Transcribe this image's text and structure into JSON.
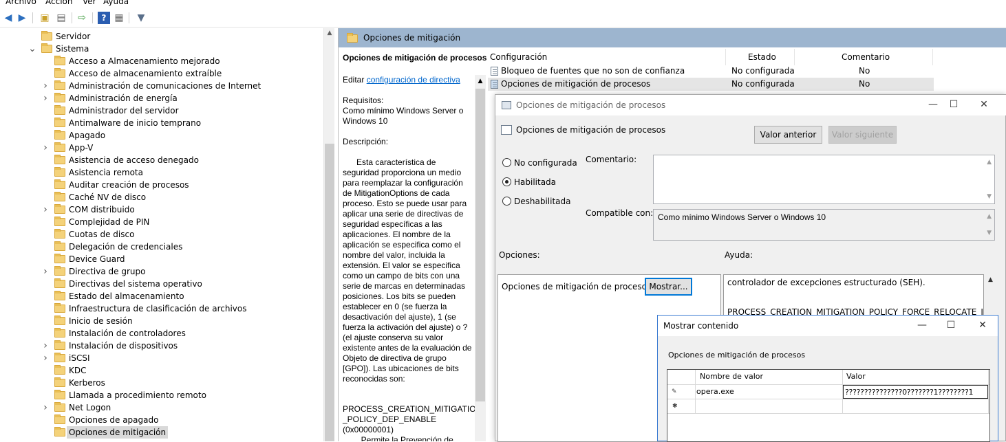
{
  "menu": {
    "items": [
      "Archivo",
      "Acción",
      "Ver",
      "Ayuda"
    ]
  },
  "tree": {
    "items": [
      {
        "label": "Servidor",
        "level": 1,
        "expander": ""
      },
      {
        "label": "Sistema",
        "level": 0,
        "expander": "v"
      },
      {
        "label": "Acceso a Almacenamiento mejorado",
        "level": 2,
        "expander": ""
      },
      {
        "label": "Acceso de almacenamiento extraíble",
        "level": 2,
        "expander": ""
      },
      {
        "label": "Administración de comunicaciones de Internet",
        "level": 2,
        "expander": ">"
      },
      {
        "label": "Administración de energía",
        "level": 2,
        "expander": ">"
      },
      {
        "label": "Administrador del servidor",
        "level": 2,
        "expander": ""
      },
      {
        "label": "Antimalware de inicio temprano",
        "level": 2,
        "expander": ""
      },
      {
        "label": "Apagado",
        "level": 2,
        "expander": ""
      },
      {
        "label": "App-V",
        "level": 2,
        "expander": ">"
      },
      {
        "label": "Asistencia de acceso denegado",
        "level": 2,
        "expander": ""
      },
      {
        "label": "Asistencia remota",
        "level": 2,
        "expander": ""
      },
      {
        "label": "Auditar creación de procesos",
        "level": 2,
        "expander": ""
      },
      {
        "label": "Caché NV de disco",
        "level": 2,
        "expander": ""
      },
      {
        "label": "COM distribuido",
        "level": 2,
        "expander": ">"
      },
      {
        "label": "Complejidad de PIN",
        "level": 2,
        "expander": ""
      },
      {
        "label": "Cuotas de disco",
        "level": 2,
        "expander": ""
      },
      {
        "label": "Delegación de credenciales",
        "level": 2,
        "expander": ""
      },
      {
        "label": "Device Guard",
        "level": 2,
        "expander": ""
      },
      {
        "label": "Directiva de grupo",
        "level": 2,
        "expander": ">"
      },
      {
        "label": "Directivas del sistema operativo",
        "level": 2,
        "expander": ""
      },
      {
        "label": "Estado del almacenamiento",
        "level": 2,
        "expander": ""
      },
      {
        "label": "Infraestructura de clasificación de archivos",
        "level": 2,
        "expander": ""
      },
      {
        "label": "Inicio de sesión",
        "level": 2,
        "expander": ""
      },
      {
        "label": "Instalación de controladores",
        "level": 2,
        "expander": ""
      },
      {
        "label": "Instalación de dispositivos",
        "level": 2,
        "expander": ">"
      },
      {
        "label": "iSCSI",
        "level": 2,
        "expander": ">"
      },
      {
        "label": "KDC",
        "level": 2,
        "expander": ""
      },
      {
        "label": "Kerberos",
        "level": 2,
        "expander": ""
      },
      {
        "label": "Llamada a procedimiento remoto",
        "level": 2,
        "expander": ""
      },
      {
        "label": "Net Logon",
        "level": 2,
        "expander": ">"
      },
      {
        "label": "Opciones de apagado",
        "level": 2,
        "expander": ""
      },
      {
        "label": "Opciones de mitigación",
        "level": 2,
        "expander": "",
        "selected": true
      }
    ]
  },
  "right_header": {
    "title": "Opciones de mitigación"
  },
  "description": {
    "title": "Opciones de mitigación de procesos",
    "edit_prefix": "Editar ",
    "edit_link": "configuración de directiva",
    "requirements_label": "Requisitos:",
    "requirements_text": "Como mínimo Windows Server o Windows 10",
    "description_label": "Descripción:",
    "body": "      Esta característica de seguridad proporciona un medio para reemplazar la configuración de MitigationOptions de cada proceso. Esto se puede usar para aplicar una serie de directivas de seguridad específicas a las aplicaciones. El nombre de la aplicación se especifica como el nombre del valor, incluida la extensión. El valor se especifica como un campo de bits con una serie de marcas en determinadas posiciones. Los bits se pueden establecer en 0 (se fuerza la desactivación del ajuste), 1 (se fuerza la activación del ajuste) o ? (el ajuste conserva su valor existente antes de la evaluación de Objeto de directiva de grupo [GPO]). Las ubicaciones de bits reconocidas son:",
    "const_line1": "PROCESS_CREATION_MITIGATION",
    "const_line2": "_POLICY_DEP_ENABLE",
    "const_line3": "(0x00000001)",
    "const_line4": "        Permite la Prevención de"
  },
  "list": {
    "headers": {
      "config": "Configuración",
      "estado": "Estado",
      "comentario": "Comentario"
    },
    "rows": [
      {
        "name": "Bloqueo de fuentes que no son de confianza",
        "estado": "No configurada",
        "comentario": "No"
      },
      {
        "name": "Opciones de mitigación de procesos",
        "estado": "No configurada",
        "comentario": "No"
      }
    ]
  },
  "dialog": {
    "window_title": "Opciones de mitigación de procesos",
    "heading": "Opciones de mitigación de procesos",
    "prev_button": "Valor anterior",
    "next_button": "Valor siguiente",
    "radio_not_configured": "No configurada",
    "radio_enabled": "Habilitada",
    "radio_disabled": "Deshabilitada",
    "comment_label": "Comentario:",
    "comment_value": "",
    "compatible_label": "Compatible con:",
    "compatible_value": "Como mínimo Windows Server o Windows 10",
    "options_label": "Opciones:",
    "help_label": "Ayuda:",
    "option_name": "Opciones de mitigación de procesos",
    "show_button": "Mostrar...",
    "help_line1": "controlador de excepciones estructurado (SEH).",
    "help_line2": "PROCESS_CREATION_MITIGATION_POLICY_FORCE_RELOCATE_IMAGE"
  },
  "show_dialog": {
    "window_title": "Mostrar contenido",
    "heading": "Opciones de mitigación de procesos",
    "col_name": "Nombre de valor",
    "col_value": "Valor",
    "row_marker_edit": "✎",
    "row_marker_new": "✱",
    "row1_name": "opera.exe",
    "row1_value": "???????????????0???????1????????1",
    "row2_name": "",
    "row2_value": ""
  }
}
